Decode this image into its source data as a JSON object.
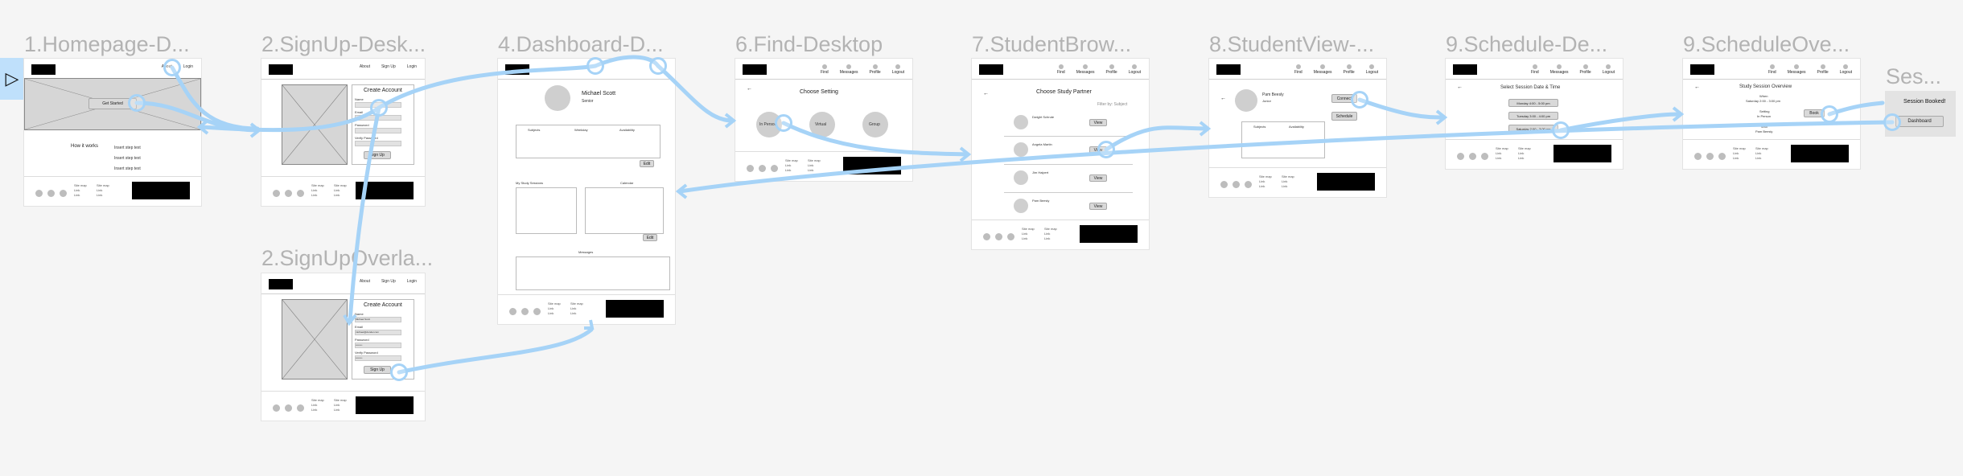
{
  "frames": {
    "f1": {
      "title": "1.Homepage-D...",
      "nav": [
        "About",
        "Login"
      ],
      "button": "Get Started",
      "how": "How it works",
      "steps": [
        "Insert step text",
        "Insert step text",
        "Insert step text"
      ]
    },
    "f2": {
      "title": "2.SignUp-Desk...",
      "nav": [
        "About",
        "Sign Up",
        "Login"
      ],
      "heading": "Create Account",
      "fields": [
        "Name",
        "Email",
        "Password",
        "Verify Password"
      ],
      "button": "Sign Up"
    },
    "f2b": {
      "title": "2.SignUpOverla...",
      "nav": [
        "About",
        "Sign Up",
        "Login"
      ],
      "heading": "Create Account",
      "fields": [
        "Name",
        "Email",
        "Password",
        "Verify Password"
      ],
      "values": [
        "Michael Scott",
        "michael@dunder.com",
        "••••••••",
        "••••••••"
      ],
      "button": "Sign Up"
    },
    "f4": {
      "title": "4.Dashboard-D...",
      "name": "Michael Scott",
      "role": "Senior",
      "cols": [
        "Subjects",
        "Weekday",
        "Availability"
      ],
      "sections": [
        "My Study Sessions",
        "Calendar",
        "Messages"
      ],
      "edit": "Edit"
    },
    "f6": {
      "title": "6.Find-Desktop",
      "nav": [
        "Find",
        "Messages",
        "Profile",
        "Logout"
      ],
      "heading": "Choose Setting",
      "options": [
        "In Person",
        "Virtual",
        "Group"
      ]
    },
    "f7": {
      "title": "7.StudentBrow...",
      "nav": [
        "Find",
        "Messages",
        "Profile",
        "Logout"
      ],
      "heading": "Choose Study Partner",
      "filter": "Filter by: Subject",
      "students": [
        "Dwight Schrute",
        "Angela Martin",
        "Jim Halpert",
        "Pam Beesly"
      ],
      "view": "View"
    },
    "f8": {
      "title": "8.StudentView-...",
      "nav": [
        "Find",
        "Messages",
        "Profile",
        "Logout"
      ],
      "name": "Pam Beesly",
      "role": "Junior",
      "buttons": [
        "Connect",
        "Schedule"
      ],
      "cols": [
        "Subjects",
        "Availability"
      ]
    },
    "f9": {
      "title": "9.Schedule-De...",
      "nav": [
        "Find",
        "Messages",
        "Profile",
        "Logout"
      ],
      "heading": "Select Session Date & Time",
      "slots": [
        "Monday 4:00 - 5:00 pm",
        "Tuesday 3:00 - 4:00 pm",
        "Saturday 2:00 - 3:00 pm"
      ]
    },
    "f9b": {
      "title": "9.ScheduleOve...",
      "nav": [
        "Find",
        "Messages",
        "Profile",
        "Logout"
      ],
      "heading": "Study Session Overview",
      "rows": [
        "When",
        "Saturday 2:00 - 3:00 pm",
        "Setting",
        "In Person",
        "With",
        "Pam Beesly"
      ],
      "button": "Book"
    },
    "f10": {
      "title": "Ses...",
      "booked": "Session Booked!",
      "button": "Dashboard"
    }
  },
  "footer": {
    "col1": [
      "Site map",
      "Link",
      "Link"
    ],
    "col2": [
      "Site map",
      "Link",
      "Link"
    ]
  },
  "colors": {
    "background": "#f5f5f5",
    "connector": "#a6d3f7",
    "frame_title": "#b3b3b3"
  },
  "icons": {
    "play": "play-icon",
    "back": "back-arrow-icon"
  }
}
